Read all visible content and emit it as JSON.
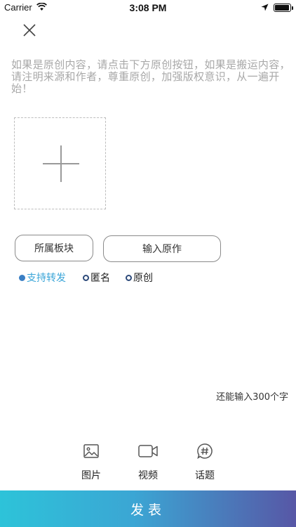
{
  "status_bar": {
    "carrier": "Carrier",
    "time": "3:08 PM",
    "battery_level": 0.95
  },
  "hint": "如果是原创内容，请点击下方原创按钮，如果是搬运内容，请注明来源和作者，尊重原创，加强版权意识，从一遍开始！",
  "buttons": {
    "board": "所属板块",
    "original_input": "输入原作"
  },
  "options": [
    {
      "label": "支持转发",
      "selected": true
    },
    {
      "label": "匿名",
      "selected": false
    },
    {
      "label": "原创",
      "selected": false
    }
  ],
  "counter": "还能输入300个字",
  "toolbar": {
    "image": "图片",
    "video": "视频",
    "topic": "话题"
  },
  "publish": "发表",
  "colors": {
    "accent_text": "#3aa5d8",
    "gradient_start": "#2dc3d9",
    "gradient_end": "#5757a6",
    "hint_text": "#a8a8a8"
  }
}
